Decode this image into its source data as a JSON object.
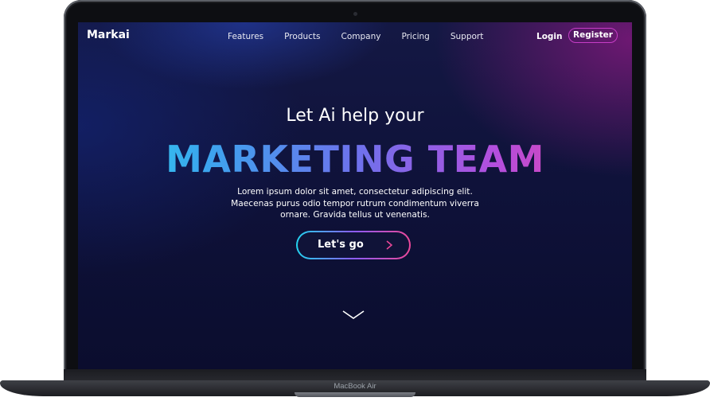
{
  "device": {
    "model_label": "MacBook Air"
  },
  "site": {
    "brand": "Markai",
    "nav": [
      "Features",
      "Products",
      "Company",
      "Pricing",
      "Support"
    ],
    "login_label": "Login",
    "register_label": "Register"
  },
  "hero": {
    "pre_title": "Let Ai help your",
    "title": "MARKETING TEAM",
    "description_lines": [
      "Lorem ipsum dolor sit amet, consectetur adipiscing elit.",
      "Maecenas purus odio tempor rutrum condimentum viverra",
      "ornare. Gravida tellus ut venenatis."
    ],
    "cta_label": "Let's go",
    "cta_icon": "arrow-right-icon",
    "scroll_icon": "chevron-down-icon"
  },
  "colors": {
    "gradient_start": "#22d3ee",
    "gradient_mid": "#8b5cf6",
    "gradient_end": "#ec4899",
    "background": "#0e1138"
  }
}
